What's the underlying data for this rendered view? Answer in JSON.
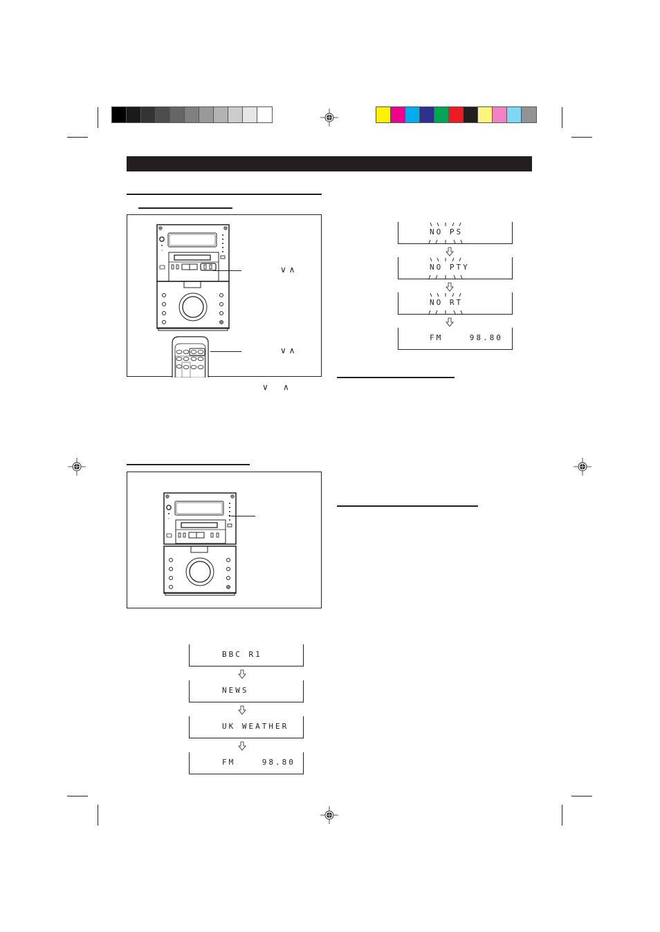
{
  "page": {
    "header_bar_title": "",
    "color_bar": {
      "grayscale": [
        "#000000",
        "#1a1a1a",
        "#333333",
        "#4d4d4d",
        "#666666",
        "#808080",
        "#999999",
        "#b3b3b3",
        "#cccccc",
        "#e6e6e6",
        "#ffffff"
      ],
      "process": [
        "#fff200",
        "#ec008c",
        "#00aeef",
        "#2e3192",
        "#00a651",
        "#ed1c24",
        "#231f20",
        "#fff57d",
        "#f381c6",
        "#7fd6f7",
        "#939393"
      ]
    }
  },
  "figure_tuning": {
    "unit_label": "",
    "remote_label": "",
    "tuning_keys_symbols": "∨ ∧",
    "remote_keys_symbols": "∨ ∧",
    "caption_symbols_down": "∨",
    "caption_symbols_up": "∧"
  },
  "figure_display": {
    "unit_label": ""
  },
  "display_sequence_left": [
    {
      "text": "BBC R1"
    },
    {
      "text": "NEWS"
    },
    {
      "text": "UK WEATHER"
    },
    {
      "text": "FM    98.80"
    }
  ],
  "display_sequence_right": [
    {
      "text": "NO PS",
      "blinking": true
    },
    {
      "text": "NO PTY",
      "blinking": true
    },
    {
      "text": "NO RT",
      "blinking": true
    },
    {
      "text": "FM    98.80",
      "blinking": false
    }
  ],
  "icons": {
    "registration_mark": "crosshair-target",
    "down_arrow": "outline-down-arrow",
    "chevron_down": "∨",
    "chevron_up": "∧"
  }
}
